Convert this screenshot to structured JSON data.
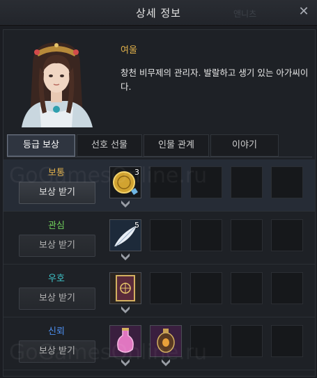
{
  "window": {
    "title": "상세 정보",
    "ghost_name": "앤니츠",
    "close_label": "✕"
  },
  "character": {
    "name": "여울",
    "description": "창천 비무제의 관리자. 발랄하고 생기 있는 아가씨이다."
  },
  "tabs": [
    {
      "label": "등급 보상",
      "active": true
    },
    {
      "label": "선호 선물",
      "active": false
    },
    {
      "label": "인물 관계",
      "active": false
    },
    {
      "label": "이야기",
      "active": false
    }
  ],
  "claim_label": "보상 받기",
  "tiers": [
    {
      "name": "보통",
      "color": "#e0b04a",
      "claimable": true,
      "items": [
        {
          "icon": "gold-coin-icon",
          "count": "3"
        }
      ]
    },
    {
      "name": "관심",
      "color": "#6fcf5a",
      "claimable": false,
      "items": [
        {
          "icon": "feather-icon",
          "count": "5"
        }
      ]
    },
    {
      "name": "우호",
      "color": "#3fc3c8",
      "claimable": false,
      "items": [
        {
          "icon": "card-box-icon",
          "count": ""
        }
      ]
    },
    {
      "name": "신뢰",
      "color": "#4d8ff0",
      "claimable": false,
      "items": [
        {
          "icon": "pink-potion-icon",
          "count": ""
        },
        {
          "icon": "lantern-icon",
          "count": ""
        }
      ]
    }
  ],
  "watermark": "GoGamesOnline.ru"
}
